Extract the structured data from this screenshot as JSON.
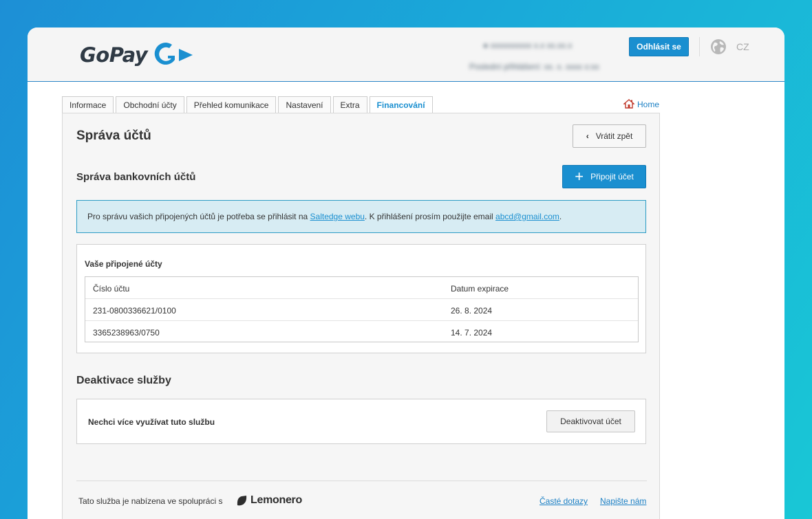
{
  "header": {
    "logo_text": "GoPay",
    "blurred_line_1": "● xxxxxxxxxx   x.x   xx.xx.x",
    "blurred_line_2": "Poslední přihlášení: xx. x. xxxx x:xx",
    "logout_label": "Odhlásit se",
    "language": "CZ"
  },
  "tabs": [
    {
      "label": "Informace"
    },
    {
      "label": "Obchodní účty"
    },
    {
      "label": "Přehled komunikace"
    },
    {
      "label": "Nastavení"
    },
    {
      "label": "Extra"
    },
    {
      "label": "Financování",
      "active": true
    }
  ],
  "home_label": "Home",
  "page": {
    "title": "Správa účtů",
    "back_label": "Vrátit zpět",
    "bank_section_title": "Správa bankovních účtů",
    "add_label": "Připojit účet",
    "info": {
      "text_1": "Pro správu vašich připojených účtů je potřeba se přihlásit na ",
      "link_1": "Saltedge webu",
      "text_2": ". K přihlášení prosím použijte email ",
      "link_2": "abcd@gmail.com",
      "text_3": "."
    },
    "accounts": {
      "title": "Vaše připojené účty",
      "columns": [
        "Číslo účtu",
        "Datum expirace"
      ],
      "rows": [
        [
          "231-0800336621/0100",
          "26. 8. 2024"
        ],
        [
          "3365238963/0750",
          "14. 7. 2024"
        ]
      ]
    },
    "deactivation": {
      "title": "Deaktivace služby",
      "text": "Nechci více využívat tuto službu",
      "button_label": "Deaktivovat účet"
    }
  },
  "footer": {
    "text": "Tato služba je nabízena ve spolupráci s",
    "partner": "Lemonero",
    "faq_label": "Časté dotazy",
    "contact_label": "Napište nám"
  },
  "colors": {
    "accent": "#1a8fd0",
    "info_bg": "#d7ecf3",
    "info_border": "#2b9bc4"
  }
}
